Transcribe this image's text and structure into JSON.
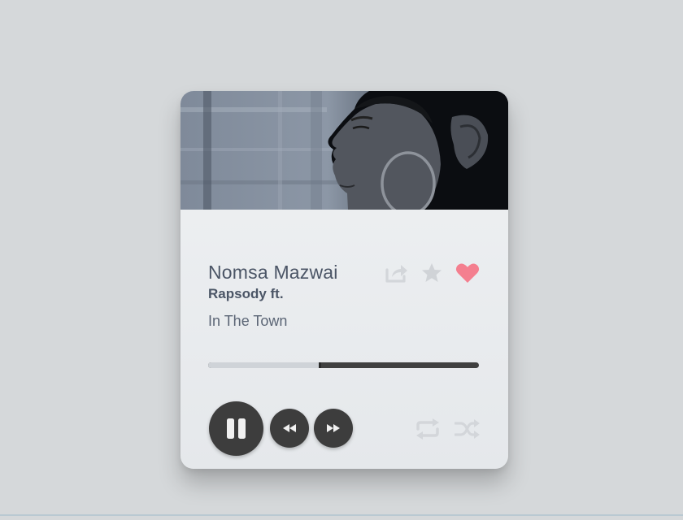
{
  "player": {
    "title": "Nomsa Mazwai",
    "artist_line": "Rapsody ft.",
    "track": "In The Town",
    "progress": 0.41,
    "is_playing": true,
    "liked": true
  },
  "icons": {
    "share": "share-icon",
    "favorite": "star-icon",
    "like": "heart-icon",
    "pause": "pause-icon",
    "rewind": "rewind-icon",
    "forward": "fast-forward-icon",
    "repeat": "repeat-icon",
    "shuffle": "shuffle-icon"
  },
  "colors": {
    "accent": "#f47f8f",
    "control": "#3d3d3d",
    "muted_icon": "#d3d6da",
    "text": "#4b5566"
  }
}
